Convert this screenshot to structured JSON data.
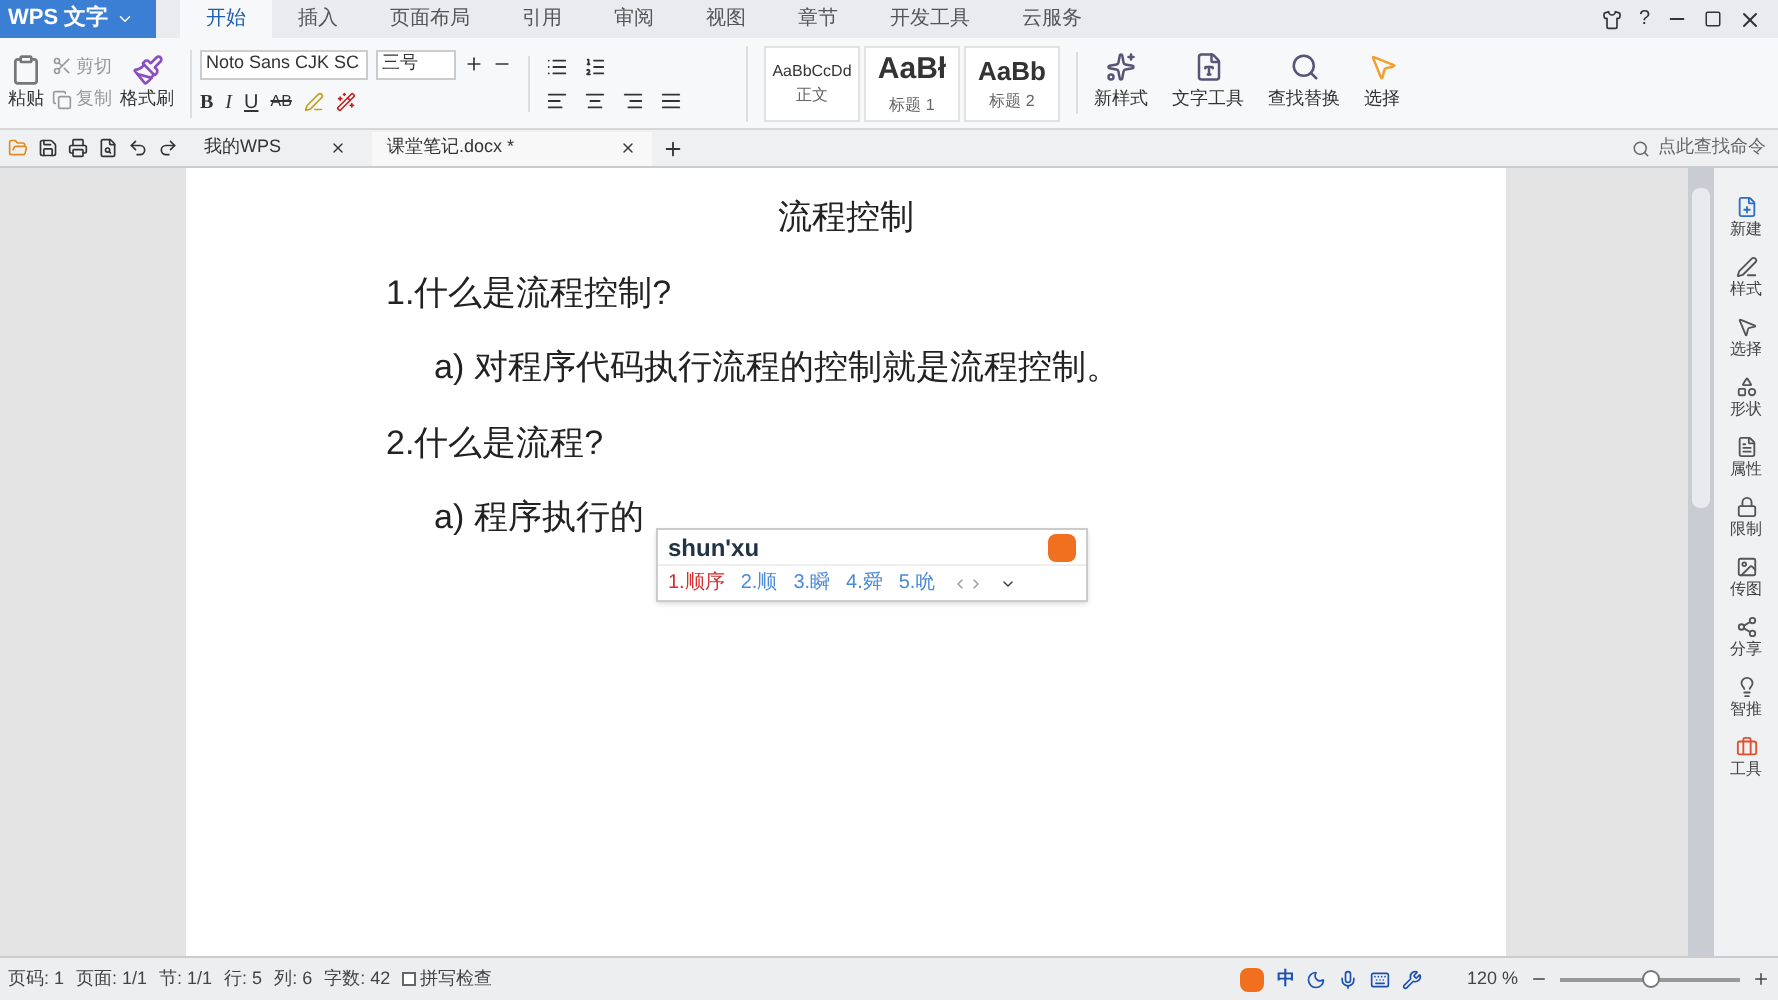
{
  "app_button": {
    "label": "WPS 文字"
  },
  "menu_tabs": [
    {
      "label": "开始",
      "selected": true
    },
    {
      "label": "插入",
      "selected": false
    },
    {
      "label": "页面布局",
      "selected": false
    },
    {
      "label": "引用",
      "selected": false
    },
    {
      "label": "审阅",
      "selected": false
    },
    {
      "label": "视图",
      "selected": false
    },
    {
      "label": "章节",
      "selected": false
    },
    {
      "label": "开发工具",
      "selected": false
    },
    {
      "label": "云服务",
      "selected": false
    }
  ],
  "window_controls": {
    "help": "?"
  },
  "ribbon": {
    "paste": "粘贴",
    "cut": "剪切",
    "copy": "复制",
    "format_painter": "格式刷",
    "font_name": "Noto Sans CJK SC",
    "font_size": "三号",
    "bold": "B",
    "italic": "I",
    "underline": "U",
    "strike": "AB",
    "styles": [
      {
        "sample": "AaBbCcDd",
        "label": "正文",
        "kind": "body"
      },
      {
        "sample": "AaBł",
        "label": "标题 1",
        "kind": "h1"
      },
      {
        "sample": "AaBb",
        "label": "标题 2",
        "kind": "h2"
      }
    ],
    "tools": [
      {
        "label": "新样式"
      },
      {
        "label": "文字工具"
      },
      {
        "label": "查找替换"
      },
      {
        "label": "选择"
      }
    ]
  },
  "doc_tabs": [
    {
      "label": "我的WPS",
      "selected": false
    },
    {
      "label": "课堂笔记.docx *",
      "selected": true
    }
  ],
  "command_search": {
    "placeholder": "点此查找命令"
  },
  "document": {
    "title": "流程控制",
    "lines": [
      {
        "text": "1.什么是流程控制?",
        "kind": "heading"
      },
      {
        "text": "a) 对程序代码执行流程的控制就是流程控制。",
        "kind": "item"
      },
      {
        "text": "2.什么是流程?",
        "kind": "heading"
      },
      {
        "text": "a) 程序执行的",
        "kind": "item"
      }
    ]
  },
  "ime": {
    "input": "shun'xu",
    "candidates": [
      {
        "text": "1.顺序",
        "selected": true
      },
      {
        "text": "2.顺",
        "selected": false
      },
      {
        "text": "3.瞬",
        "selected": false
      },
      {
        "text": "4.舜",
        "selected": false
      },
      {
        "text": "5.吮",
        "selected": false
      }
    ]
  },
  "side_panel": [
    {
      "label": "新建"
    },
    {
      "label": "样式"
    },
    {
      "label": "选择"
    },
    {
      "label": "形状"
    },
    {
      "label": "属性"
    },
    {
      "label": "限制"
    },
    {
      "label": "传图"
    },
    {
      "label": "分享"
    },
    {
      "label": "智推"
    },
    {
      "label": "工具"
    }
  ],
  "status_bar": {
    "items": [
      "页码: 1",
      "页面: 1/1",
      "节: 1/1",
      "行: 5",
      "列: 6",
      "字数: 42"
    ],
    "spell_check": {
      "label": "拼写检查",
      "checked": false
    },
    "ime_label": "中",
    "zoom": "120 %",
    "zoom_slider": {
      "level": 0.5
    }
  }
}
